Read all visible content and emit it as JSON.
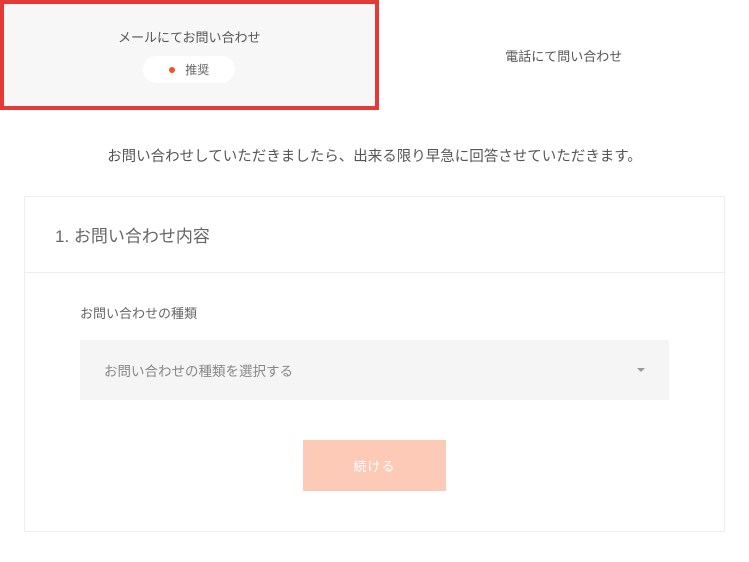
{
  "tabs": {
    "email": {
      "label": "メールにてお問い合わせ",
      "badge": "推奨"
    },
    "phone": {
      "label": "電話にて問い合わせ"
    }
  },
  "description": "お問い合わせしていただきましたら、出来る限り早急に回答させていただきます。",
  "section": {
    "title": "1. お問い合わせ内容"
  },
  "form": {
    "inquiryType": {
      "label": "お問い合わせの種類",
      "placeholder": "お問い合わせの種類を選択する"
    },
    "continueButton": "続ける"
  }
}
